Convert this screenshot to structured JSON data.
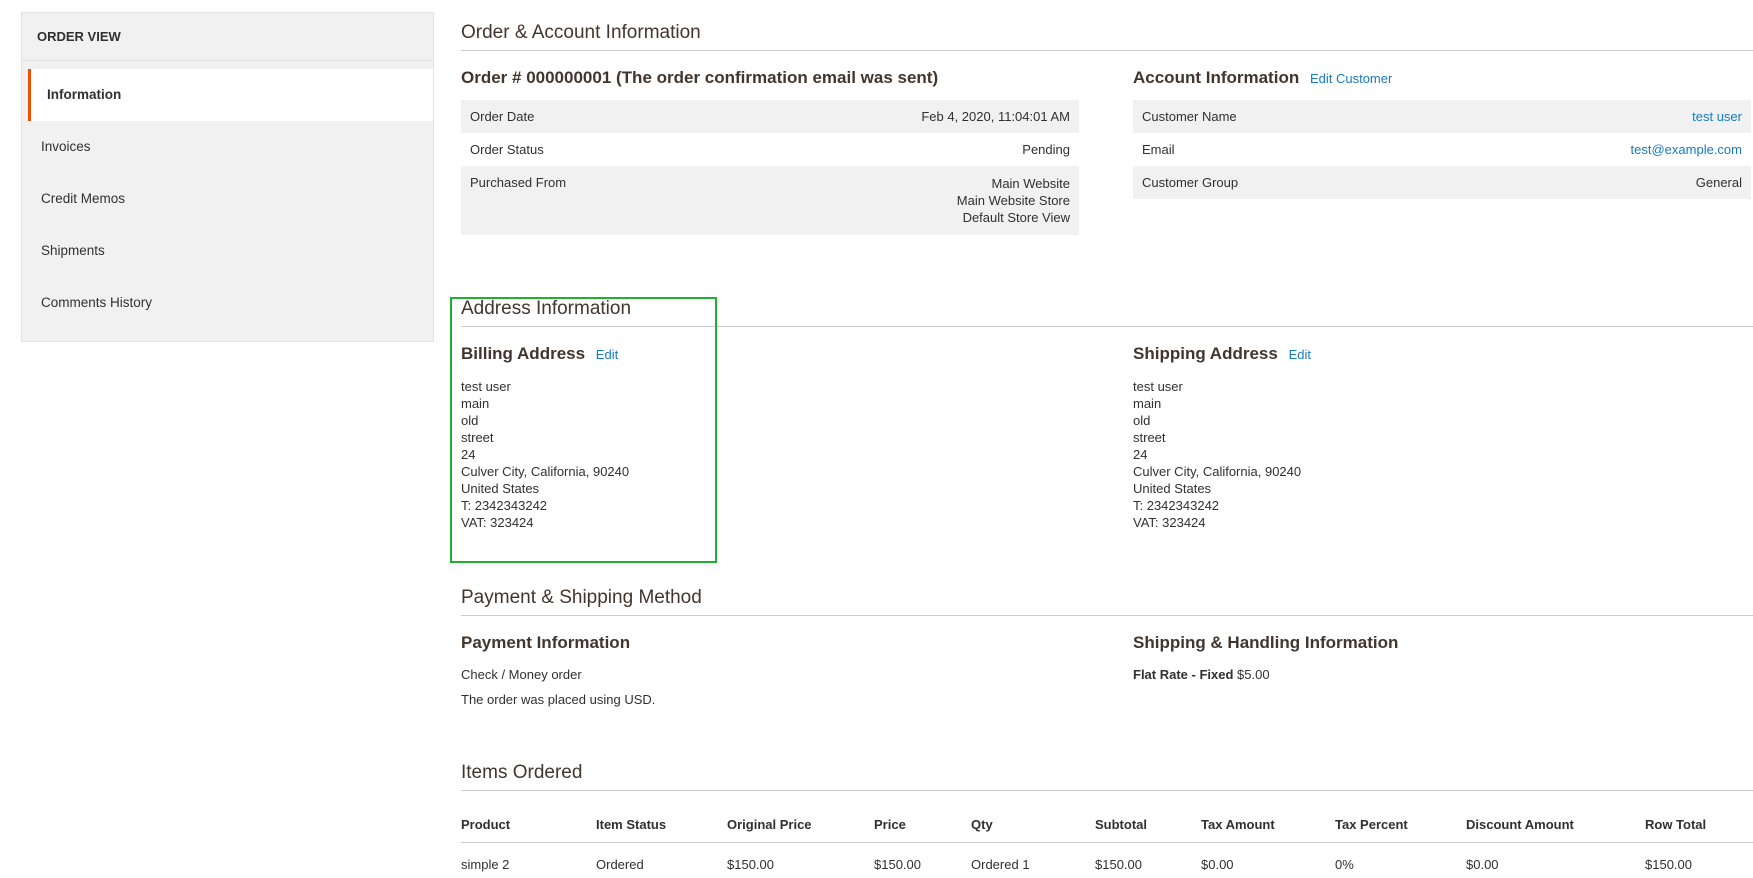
{
  "sidebar": {
    "title": "ORDER VIEW",
    "tabs": [
      {
        "label": "Information"
      },
      {
        "label": "Invoices"
      },
      {
        "label": "Credit Memos"
      },
      {
        "label": "Shipments"
      },
      {
        "label": "Comments History"
      }
    ]
  },
  "order_account": {
    "section_title": "Order & Account Information",
    "order_heading": "Order # 000000001 (The order confirmation email was sent)",
    "rows": {
      "order_date": {
        "label": "Order Date",
        "value": "Feb 4, 2020, 11:04:01 AM"
      },
      "order_status": {
        "label": "Order Status",
        "value": "Pending"
      },
      "purchased_from": {
        "label": "Purchased From",
        "lines": [
          "Main Website",
          "Main Website Store",
          "Default Store View"
        ]
      }
    },
    "account": {
      "heading": "Account Information",
      "edit_link": "Edit Customer",
      "customer_name": {
        "label": "Customer Name",
        "value": "test user"
      },
      "email": {
        "label": "Email",
        "value": "test@example.com"
      },
      "customer_group": {
        "label": "Customer Group",
        "value": "General"
      }
    }
  },
  "address": {
    "section_title": "Address Information",
    "billing": {
      "heading": "Billing Address",
      "edit_link": "Edit",
      "lines": [
        "test user",
        "main",
        "old",
        "street",
        "24",
        "Culver City, California, 90240",
        "United States",
        "T: 2342343242",
        "VAT: 323424"
      ]
    },
    "shipping": {
      "heading": "Shipping Address",
      "edit_link": "Edit",
      "lines": [
        "test user",
        "main",
        "old",
        "street",
        "24",
        "Culver City, California, 90240",
        "United States",
        "T: 2342343242",
        "VAT: 323424"
      ]
    }
  },
  "payment_shipping": {
    "section_title": "Payment & Shipping Method",
    "payment_heading": "Payment Information",
    "payment_method": "Check / Money order",
    "payment_note": "The order was placed using USD.",
    "shipping_heading": "Shipping & Handling Information",
    "shipping_method": "Flat Rate - Fixed",
    "shipping_price": "$5.00"
  },
  "items": {
    "section_title": "Items Ordered",
    "columns": [
      "Product",
      "Item Status",
      "Original Price",
      "Price",
      "Qty",
      "Subtotal",
      "Tax Amount",
      "Tax Percent",
      "Discount Amount",
      "Row Total"
    ],
    "rows": [
      {
        "product": "simple 2",
        "status": "Ordered",
        "original_price": "$150.00",
        "price": "$150.00",
        "qty_label": "Ordered",
        "qty": "1",
        "subtotal": "$150.00",
        "tax_amount": "$0.00",
        "tax_percent": "0%",
        "discount": "$0.00",
        "row_total": "$150.00"
      }
    ]
  },
  "highlight_color": "#22b02c",
  "accent_color": "#eb5202",
  "link_color": "#1979c3"
}
